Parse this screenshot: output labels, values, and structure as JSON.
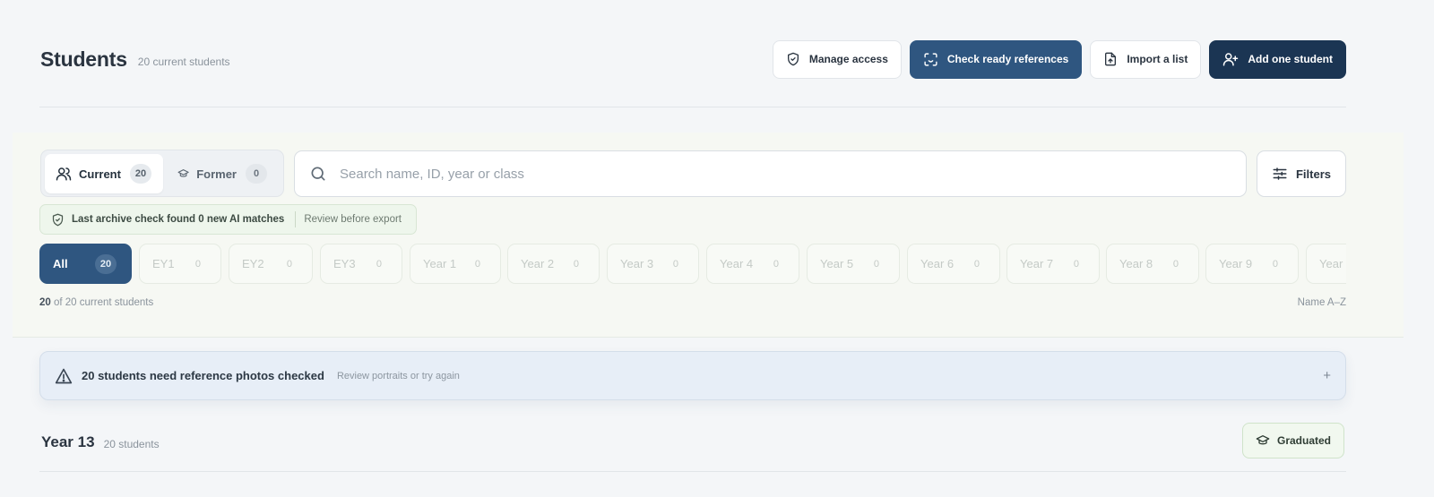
{
  "header": {
    "title": "Students",
    "subtitle": "20 current students",
    "actions": {
      "manage_access": "Manage access",
      "check_refs": "Check ready references",
      "import_list": "Import a list",
      "add_student": "Add one student"
    }
  },
  "segment": {
    "current": {
      "label": "Current",
      "count": "20"
    },
    "former": {
      "label": "Former",
      "count": "0"
    }
  },
  "search": {
    "placeholder": "Search name, ID, year or class"
  },
  "filters": {
    "label": "Filters"
  },
  "archive": {
    "message": "Last archive check found 0 new AI matches",
    "link": "Review before export"
  },
  "chips": [
    {
      "label": "All",
      "count": "20"
    },
    {
      "label": "EY1",
      "count": "0"
    },
    {
      "label": "EY2",
      "count": "0"
    },
    {
      "label": "EY3",
      "count": "0"
    },
    {
      "label": "Year 1",
      "count": "0"
    },
    {
      "label": "Year 2",
      "count": "0"
    },
    {
      "label": "Year 3",
      "count": "0"
    },
    {
      "label": "Year 4",
      "count": "0"
    },
    {
      "label": "Year 5",
      "count": "0"
    },
    {
      "label": "Year 6",
      "count": "0"
    },
    {
      "label": "Year 7",
      "count": "0"
    },
    {
      "label": "Year 8",
      "count": "0"
    },
    {
      "label": "Year 9",
      "count": "0"
    },
    {
      "label": "Year",
      "count": ""
    }
  ],
  "results": {
    "shown": "20",
    "rest": " of 20 current students",
    "sort": "Name A–Z"
  },
  "alert": {
    "title": "20 students need reference photos checked",
    "hint": "Review portraits or try again",
    "expand": "+"
  },
  "group": {
    "title": "Year 13",
    "count": "20 students",
    "badge": "Graduated"
  },
  "colors": {
    "primary": "#2f5680",
    "dark": "#1b3553",
    "success_bg": "#eef6ec",
    "info_bg": "#e7eef7"
  }
}
